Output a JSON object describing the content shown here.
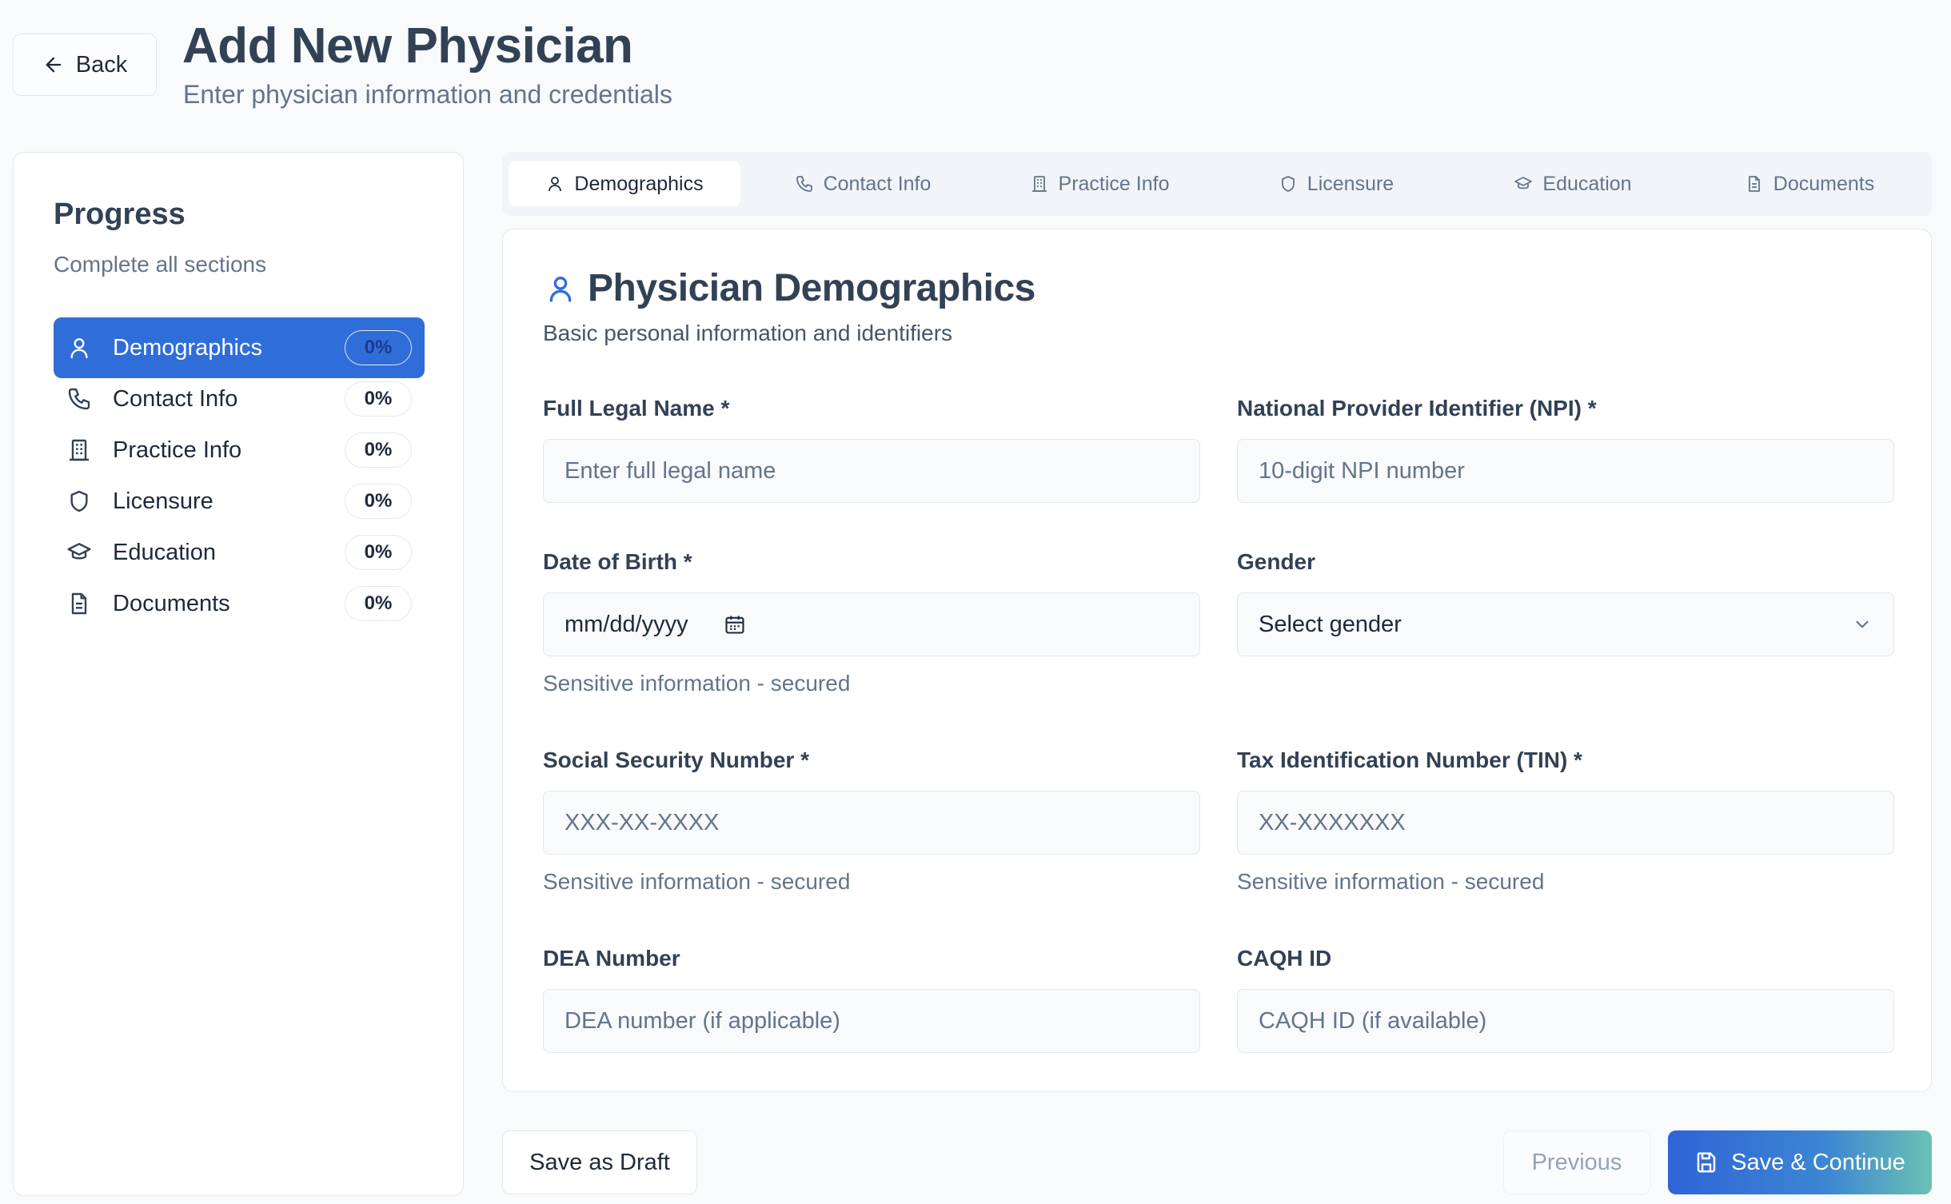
{
  "header": {
    "back_label": "Back",
    "title": "Add New Physician",
    "subtitle": "Enter physician information and credentials"
  },
  "sidebar": {
    "title": "Progress",
    "subtitle": "Complete all sections",
    "items": [
      {
        "label": "Demographics",
        "percent": "0%",
        "icon": "user-icon",
        "active": true
      },
      {
        "label": "Contact Info",
        "percent": "0%",
        "icon": "phone-icon",
        "active": false
      },
      {
        "label": "Practice Info",
        "percent": "0%",
        "icon": "building-icon",
        "active": false
      },
      {
        "label": "Licensure",
        "percent": "0%",
        "icon": "shield-icon",
        "active": false
      },
      {
        "label": "Education",
        "percent": "0%",
        "icon": "graduation-cap-icon",
        "active": false
      },
      {
        "label": "Documents",
        "percent": "0%",
        "icon": "document-icon",
        "active": false
      }
    ]
  },
  "tabs": [
    {
      "label": "Demographics",
      "icon": "user-icon",
      "active": true
    },
    {
      "label": "Contact Info",
      "icon": "phone-icon",
      "active": false
    },
    {
      "label": "Practice Info",
      "icon": "building-icon",
      "active": false
    },
    {
      "label": "Licensure",
      "icon": "shield-icon",
      "active": false
    },
    {
      "label": "Education",
      "icon": "graduation-cap-icon",
      "active": false
    },
    {
      "label": "Documents",
      "icon": "document-icon",
      "active": false
    }
  ],
  "card": {
    "title": "Physician Demographics",
    "subtitle": "Basic personal information and identifiers"
  },
  "form": {
    "full_name": {
      "label": "Full Legal Name *",
      "placeholder": "Enter full legal name"
    },
    "npi": {
      "label": "National Provider Identifier (NPI) *",
      "placeholder": "10-digit NPI number"
    },
    "dob": {
      "label": "Date of Birth *",
      "placeholder": "mm/dd/yyyy",
      "hint": "Sensitive information - secured"
    },
    "gender": {
      "label": "Gender",
      "value": "Select gender"
    },
    "ssn": {
      "label": "Social Security Number *",
      "placeholder": "XXX-XX-XXXX",
      "hint": "Sensitive information - secured"
    },
    "tin": {
      "label": "Tax Identification Number (TIN) *",
      "placeholder": "XX-XXXXXXX",
      "hint": "Sensitive information - secured"
    },
    "dea": {
      "label": "DEA Number",
      "placeholder": "DEA number (if applicable)"
    },
    "caqh": {
      "label": "CAQH ID",
      "placeholder": "CAQH ID (if available)"
    }
  },
  "actions": {
    "save_draft": "Save as Draft",
    "previous": "Previous",
    "save_continue": "Save & Continue"
  },
  "colors": {
    "accent": "#2f6ed9",
    "background": "#f8fafc",
    "text": "#334155",
    "muted": "#64748b"
  }
}
